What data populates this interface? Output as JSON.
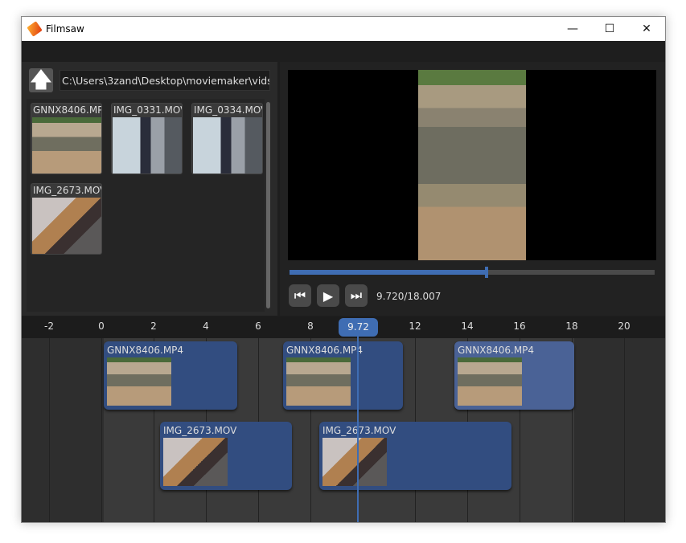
{
  "window": {
    "title": "Filmsaw",
    "minimize": "—",
    "maximize": "☐",
    "close": "✕",
    "app_icon": "filmsaw-logo-icon"
  },
  "browser": {
    "path": "C:\\Users\\3zand\\Desktop\\moviemaker\\vids",
    "up_icon": "arrow-up-icon",
    "files": [
      {
        "name": "GNNX8406.MP4"
      },
      {
        "name": "IMG_0331.MOV"
      },
      {
        "name": "IMG_0334.MOV"
      },
      {
        "name": "IMG_2673.MOV"
      }
    ]
  },
  "player": {
    "time": "9.720/18.007",
    "progress": 0.54,
    "skip_back_icon": "skip-back-icon",
    "play_icon": "play-icon",
    "skip_forward_icon": "skip-forward-icon"
  },
  "timeline": {
    "ticks": [
      "-2",
      "0",
      "2",
      "4",
      "6",
      "8",
      "12",
      "14",
      "16",
      "18",
      "20"
    ],
    "playhead": "9.72",
    "clips": [
      {
        "name": "GNNX8406.MP4",
        "track": 1
      },
      {
        "name": "GNNX8406.MP4",
        "track": 1
      },
      {
        "name": "GNNX8406.MP4",
        "track": 1,
        "selected": true
      },
      {
        "name": "IMG_2673.MOV",
        "track": 2
      },
      {
        "name": "IMG_2673.MOV",
        "track": 2
      }
    ]
  },
  "colors": {
    "accent": "#3f6db3",
    "clip": "#324d80",
    "clip_selected": "#4a6296"
  }
}
